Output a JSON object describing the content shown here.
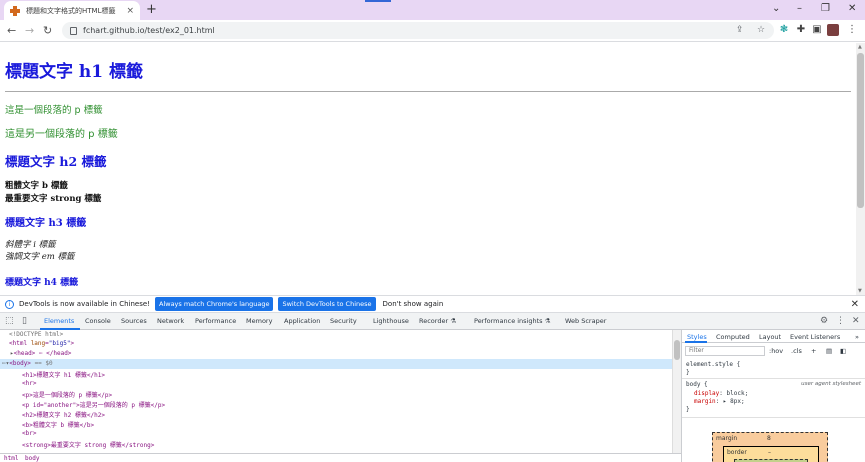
{
  "browser": {
    "tab_title": "標題和文字格式的HTML標籤",
    "tab_close": "×",
    "new_tab": "+",
    "url": "fchart.github.io/test/ex2_01.html",
    "window_controls": [
      "⌄",
      "–",
      "❐",
      "✕"
    ]
  },
  "page": {
    "h1": "標題文字 h1 標籤",
    "p1": "這是一個段落的 p 標籤",
    "p2": "這是另一個段落的 p 標籤",
    "h2": "標題文字 h2 標籤",
    "b_text": "粗體文字 b 標籤",
    "strong_text": "最重要文字 strong 標籤",
    "h3": "標題文字 h3 標籤",
    "i_text": "斜體字 i 標籤",
    "em_text": "強調文字 em 標籤",
    "h4": "標題文字 h4 標籤"
  },
  "infobar": {
    "message": "DevTools is now available in Chinese!",
    "btn_match": "Always match Chrome's language",
    "btn_switch": "Switch DevTools to Chinese",
    "dont_show": "Don't show again"
  },
  "devtools": {
    "tabs": [
      "Elements",
      "Console",
      "Sources",
      "Network",
      "Performance",
      "Memory",
      "Application",
      "Security",
      "Lighthouse",
      "Recorder ⚗",
      "Performance insights ⚗",
      "Web Scraper"
    ],
    "elements": {
      "doctype": "<!DOCTYPE html>",
      "html_open_tag": "<html ",
      "html_lang_attr": "lang",
      "html_lang_val": "\"big5\"",
      "head": "<head> ⋯ </head>",
      "body_open": "<body>",
      "body_marker": "== $0",
      "lines": [
        "<h1>標題文字 h1 標籤</h1>",
        "<hr>",
        "<p>這是一個段落的 p 標籤</p>",
        "<p id=\"another\">這是另一個段落的 p 標籤</p>",
        "<h2>標題文字 h2 標籤</h2>",
        "<b>粗體文字 b 標籤</b>",
        "<br>",
        "<strong>最重要文字 strong 標籤</strong>"
      ]
    },
    "styles": {
      "tabs": [
        "Styles",
        "Computed",
        "Layout",
        "Event Listeners",
        "»"
      ],
      "filter_placeholder": "Filter",
      "hov": ":hov",
      "cls": ".cls",
      "element_style": "element.style {",
      "close_brace": "}",
      "body_rule": "body {",
      "user_agent": "user agent stylesheet",
      "display_prop": "display",
      "display_val": "block;",
      "margin_prop": "margin",
      "margin_val": "▸ 8px;",
      "box_margin_label": "margin",
      "box_margin_value": "8",
      "box_border_label": "border",
      "box_border_value": "–"
    },
    "breadcrumbs": [
      "html",
      "body"
    ]
  }
}
